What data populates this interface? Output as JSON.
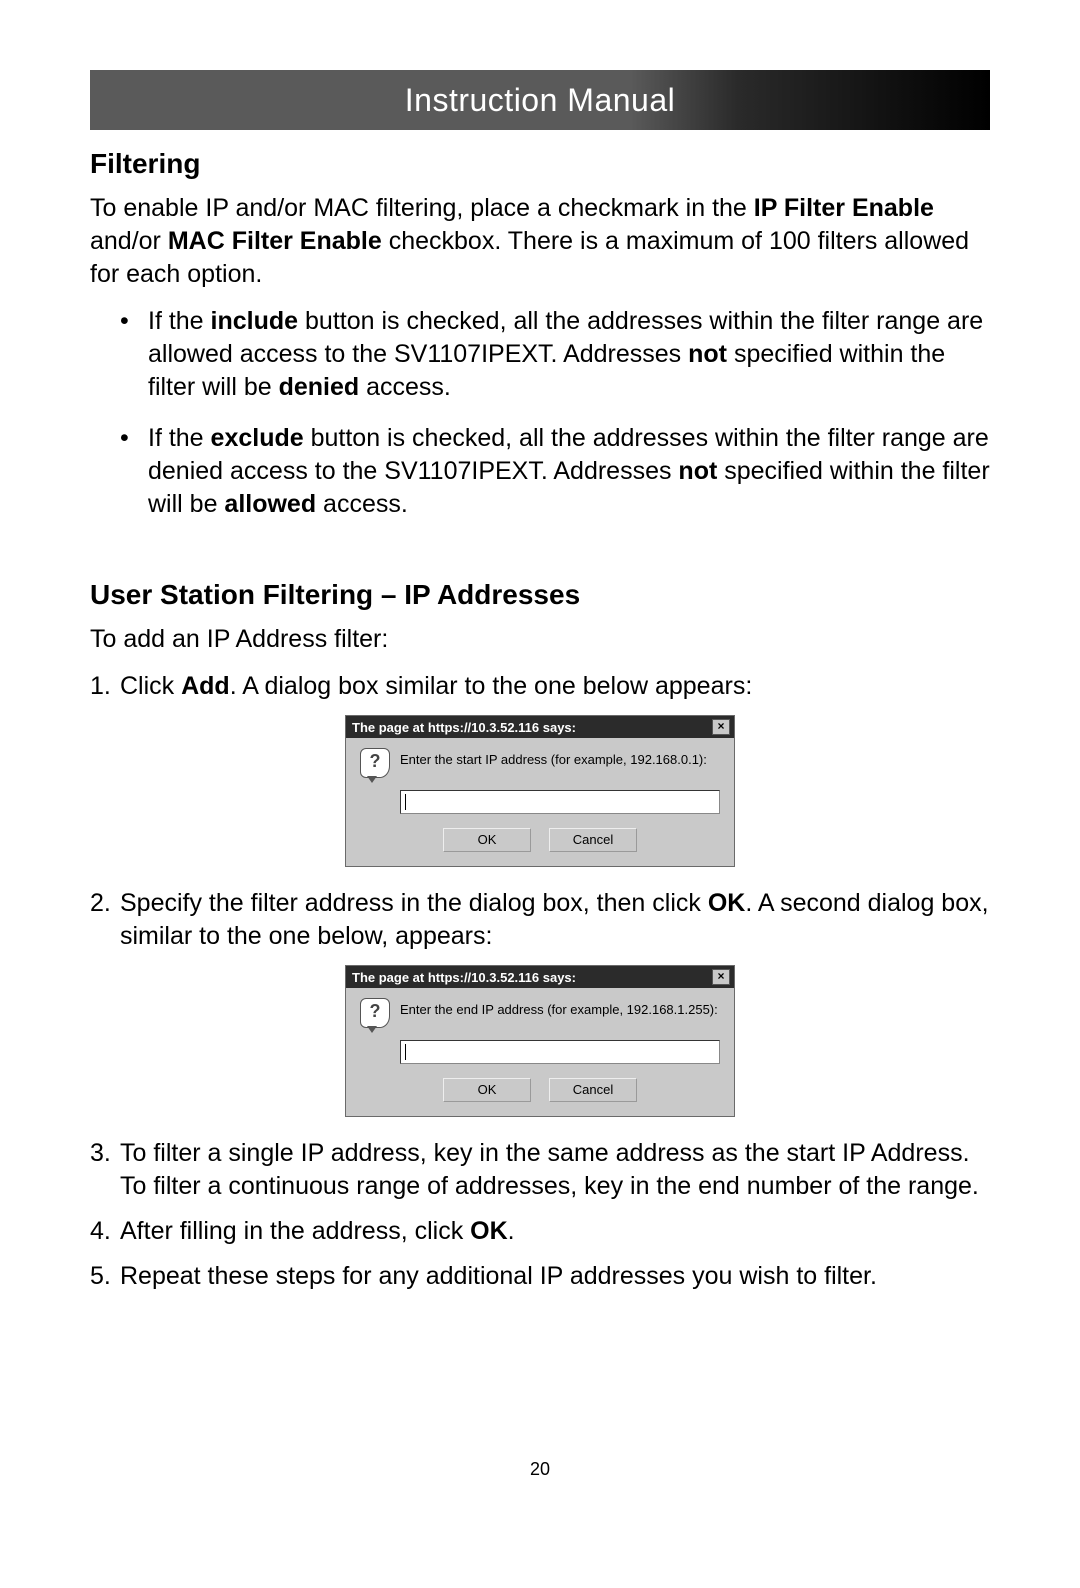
{
  "header": {
    "title": "Instruction Manual"
  },
  "section1": {
    "heading": "Filtering",
    "intro_pre": "To enable IP and/or MAC filtering, place a checkmark in the ",
    "intro_b1": "IP Filter Enable",
    "intro_mid1": " and/or ",
    "intro_b2": "MAC Filter Enable",
    "intro_post": " checkbox. There is a maximum of 100 filters allowed for each option.",
    "bullet1_pre": "If the ",
    "bullet1_b1": "include",
    "bullet1_mid1": " button is checked, all the addresses within the filter range are allowed access to the SV1107IPEXT.  Addresses ",
    "bullet1_b2": "not",
    "bullet1_mid2": " specified within the filter will be ",
    "bullet1_b3": "denied",
    "bullet1_post": " access.",
    "bullet2_pre": "If the ",
    "bullet2_b1": "exclude",
    "bullet2_mid1": " button is checked, all the addresses within the filter range are denied access to the SV1107IPEXT.  Addresses ",
    "bullet2_b2": "not",
    "bullet2_mid2": " specified within the filter will be ",
    "bullet2_b3": "allowed",
    "bullet2_post": " access."
  },
  "section2": {
    "heading": "User Station Filtering – IP Addresses",
    "intro": "To add an IP Address filter:",
    "step1_pre": "Click ",
    "step1_b": "Add",
    "step1_post": ". A dialog box similar to the one below appears:",
    "step2_pre": "Specify the filter address in the dialog box, then click ",
    "step2_b": "OK",
    "step2_post": ".  A second dialog box, similar to the one below, appears:",
    "step3": "To filter a single IP address, key in the same address as the start IP Address. To filter a continuous range of addresses, key in the end number of the range.",
    "step4_pre": "After filling in the address, click ",
    "step4_b": "OK",
    "step4_post": ".",
    "step5": "Repeat these steps for any additional IP addresses you wish to filter."
  },
  "dialog1": {
    "title": "The page at https://10.3.52.116 says:",
    "prompt": "Enter the start IP address (for example, 192.168.0.1):",
    "ok": "OK",
    "cancel": "Cancel"
  },
  "dialog2": {
    "title": "The page at https://10.3.52.116 says:",
    "prompt": "Enter the end IP address (for example, 192.168.1.255):",
    "ok": "OK",
    "cancel": "Cancel"
  },
  "page_number": "20"
}
